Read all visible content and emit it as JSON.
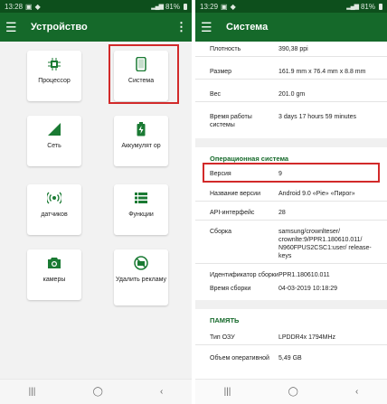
{
  "left": {
    "status": {
      "time": "13:28",
      "battery": "81%"
    },
    "appbar": {
      "title": "Устройство"
    },
    "cards": [
      {
        "label": "Процессор",
        "icon": "cpu-icon"
      },
      {
        "label": "Система",
        "icon": "smartphone-icon"
      },
      {
        "label": "Сеть",
        "icon": "signal-icon"
      },
      {
        "label": "Аккумулят ор",
        "icon": "battery-icon"
      },
      {
        "label": "датчиков",
        "icon": "sensors-icon"
      },
      {
        "label": "Функции",
        "icon": "list-icon"
      },
      {
        "label": "камеры",
        "icon": "camera-icon"
      },
      {
        "label": "Удалить рекламу",
        "icon": "no-ads-icon"
      }
    ]
  },
  "right": {
    "status": {
      "time": "13:29",
      "battery": "81%"
    },
    "appbar": {
      "title": "Система"
    },
    "display_rows": [
      {
        "key": "Плотность",
        "value": "390,38 ppi"
      },
      {
        "key": "Размер",
        "value": "161.9 mm x 76.4 mm x 8.8 mm"
      },
      {
        "key": "Вес",
        "value": "201.0 gm"
      },
      {
        "key": "Время работы системы",
        "value": "3 days 17 hours 59 minutes"
      }
    ],
    "os_section": "Операционная система",
    "os_rows": [
      {
        "key": "Версия",
        "value": "9"
      },
      {
        "key": "Название версии",
        "value": "Android 9.0 «Pie» «Пирог»"
      },
      {
        "key": "API-интерфейс",
        "value": "28"
      },
      {
        "key": "Сборка",
        "value": "samsung/crownlteser/ crownlte:9/PPR1.180610.011/ N960FPUS2CSC1:user/ release-keys"
      },
      {
        "key": "Идентификатор сборки",
        "value": "PPR1.180610.011"
      },
      {
        "key": "Время сборки",
        "value": "04-03-2019 10:18:29"
      }
    ],
    "memory_section": "ПАМЯТЬ",
    "memory_rows": [
      {
        "key": "Тип ОЗУ",
        "value": "LPDDR4x 1794MHz"
      },
      {
        "key": "Объем оперативной",
        "value": "5,49 GB"
      }
    ]
  },
  "nav": {
    "recent": "|||",
    "home": "◯",
    "back": "‹"
  }
}
